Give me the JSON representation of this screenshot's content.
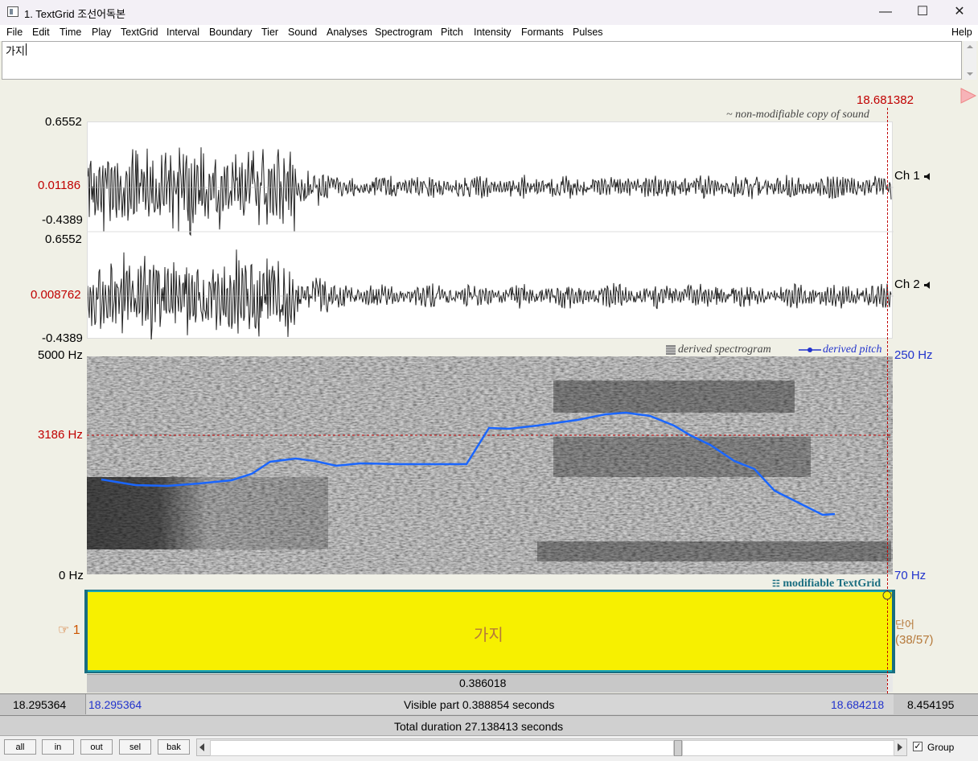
{
  "window": {
    "title": "1. TextGrid 조선어독본",
    "minimize_glyph": "—",
    "maximize_glyph": "☐",
    "close_glyph": "✕"
  },
  "menu": [
    "File",
    "Edit",
    "Time",
    "Play",
    "TextGrid",
    "Interval",
    "Boundary",
    "Tier",
    "Sound",
    "Analyses",
    "Spectrogram",
    "Pitch",
    "Intensity",
    "Formants",
    "Pulses"
  ],
  "help_label": "Help",
  "text_field": {
    "value": "가지"
  },
  "cursor_time": "18.681382",
  "sound": {
    "note": "~ non-modifiable copy of sound",
    "ch1": {
      "top": "0.6552",
      "mid": "0.01186",
      "bottom": "-0.4389",
      "label": "Ch 1"
    },
    "ch2": {
      "top": "0.6552",
      "mid": "0.008762",
      "bottom": "-0.4389",
      "label": "Ch 2"
    }
  },
  "spectrogram": {
    "legend_spec": "derived spectrogram",
    "legend_pitch": "derived pitch",
    "freq_top": "5000 Hz",
    "freq_cursor": "3186 Hz",
    "freq_bottom": "0 Hz",
    "pitch_top": "250 Hz",
    "pitch_bottom": "70 Hz"
  },
  "textgrid": {
    "note": "modifiable TextGrid",
    "tier_number": "1",
    "interval_text": "가지",
    "tier_name": "단어",
    "tier_count": "(38/57)"
  },
  "durations": {
    "selection": "0.386018",
    "left_outer": "18.295364",
    "left_visible": "18.295364",
    "visible_part": "Visible part 0.388854 seconds",
    "right_visible": "18.684218",
    "right_outer": "8.454195",
    "total": "Total duration 27.138413 seconds"
  },
  "buttons": [
    "all",
    "in",
    "out",
    "sel",
    "bak"
  ],
  "group_label": "Group",
  "colors": {
    "interval_fill": "#f7f000",
    "pitch": "#1a66ff",
    "cursor": "#c00000",
    "tier_border": "#1aa7b8"
  }
}
